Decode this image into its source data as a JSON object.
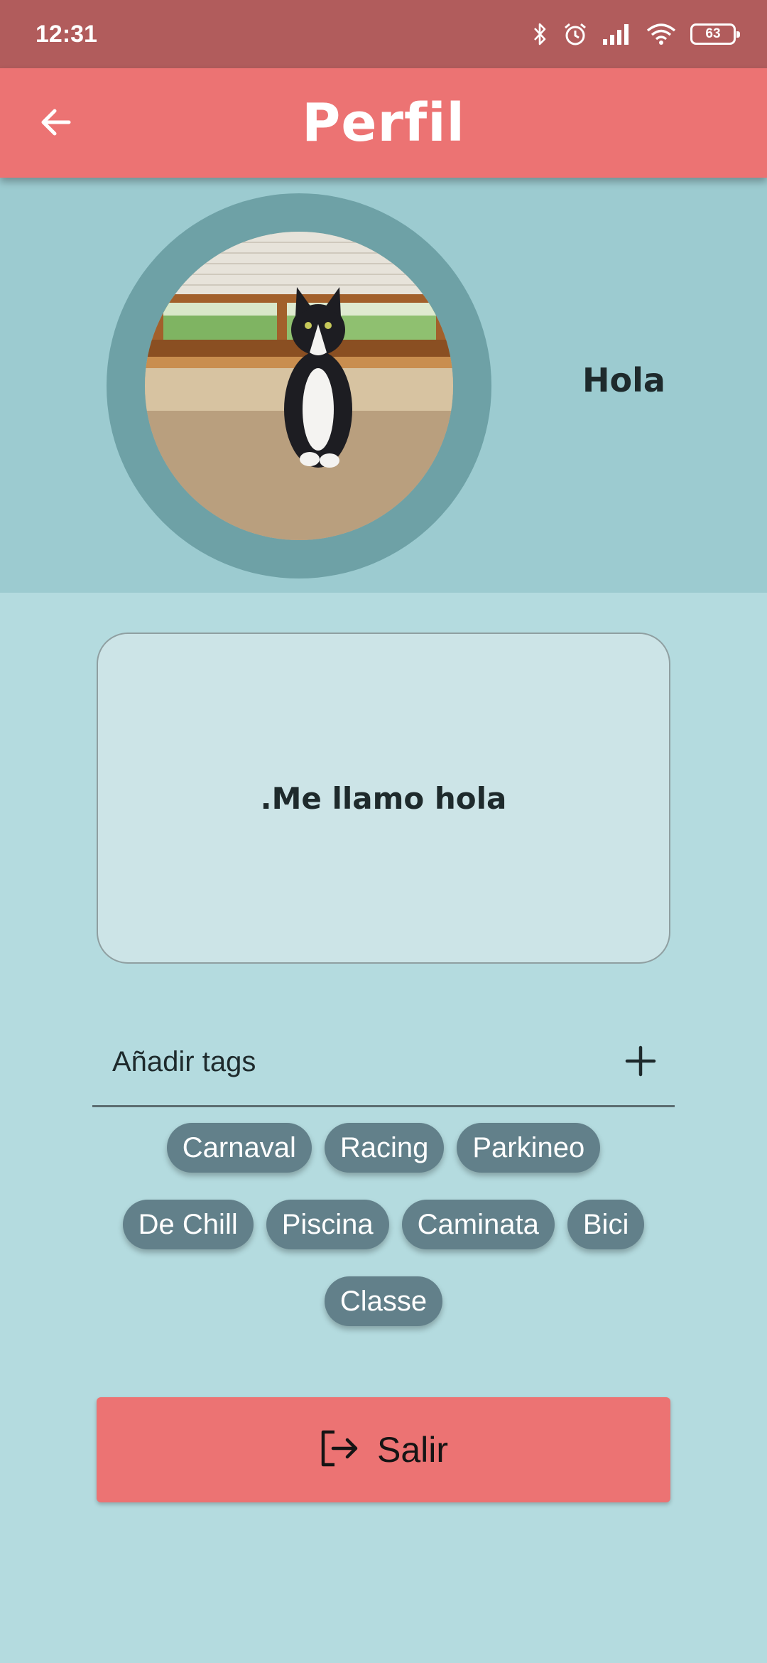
{
  "status_bar": {
    "time": "12:31",
    "battery_level": "63",
    "icons": [
      "bluetooth-icon",
      "alarm-icon",
      "signal-icon",
      "wifi-icon",
      "battery-icon"
    ]
  },
  "app_bar": {
    "title": "Perfil",
    "back_icon": "arrow-left-icon"
  },
  "profile": {
    "username": "Hola",
    "avatar_description": "cat-photo",
    "bio": ".Me llamo hola"
  },
  "tags": {
    "input_placeholder": "Añadir tags",
    "add_icon": "plus-icon",
    "items": [
      "Carnaval",
      "Racing",
      "Parkineo",
      "De Chill",
      "Piscina",
      "Caminata",
      "Bici",
      "Classe"
    ]
  },
  "exit_button": {
    "label": "Salir",
    "icon": "logout-icon"
  },
  "colors": {
    "status_bar": "#b15c5c",
    "app_bar": "#ec7373",
    "header_bg": "#9ccbd0",
    "page_bg": "#b4dbdf",
    "avatar_ring": "#6ea1a6",
    "chip_bg": "#62808a",
    "exit_button": "#ec7373"
  }
}
